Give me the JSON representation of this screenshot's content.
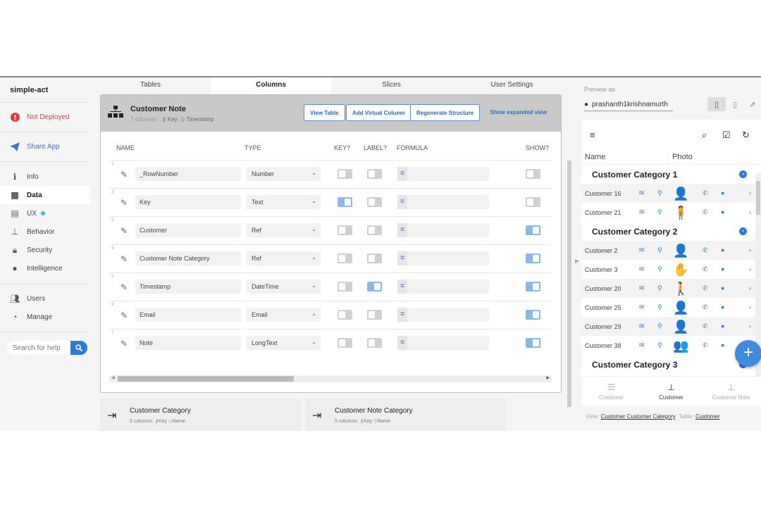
{
  "sidebar": {
    "app_name": "simple-act",
    "deploy_status": "Not Deployed",
    "share": "Share App",
    "nav": [
      {
        "label": "Info",
        "icon": "info-icon"
      },
      {
        "label": "Data",
        "icon": "grid-icon",
        "active": true
      },
      {
        "label": "UX",
        "icon": "ux-icon",
        "badge": true
      },
      {
        "label": "Behavior",
        "icon": "hierarchy-icon"
      },
      {
        "label": "Security",
        "icon": "lock-icon"
      },
      {
        "label": "Intelligence",
        "icon": "lightbulb-icon"
      }
    ],
    "nav2": [
      {
        "label": "Users",
        "icon": "users-icon"
      },
      {
        "label": "Manage",
        "icon": "dashboard-icon"
      }
    ],
    "search_placeholder": "Search for help"
  },
  "tabs": [
    "Tables",
    "Columns",
    "Slices",
    "User Settings"
  ],
  "active_tab": "Columns",
  "table": {
    "title": "Customer Note",
    "count": "7 columns:",
    "key": "Key",
    "label": "Timestamp",
    "buttons": {
      "view": "View Table",
      "add": "Add Virtual Column",
      "regen": "Regenerate Structure"
    },
    "expand_link": "Show expanded view",
    "headers": {
      "name": "NAME",
      "type": "TYPE",
      "key": "KEY?",
      "label": "LABEL?",
      "formula": "FORMULA",
      "show": "SHOW?"
    },
    "rows": [
      {
        "n": "1",
        "name": "_RowNumber",
        "type": "Number",
        "key": false,
        "label": false,
        "show": false
      },
      {
        "n": "2",
        "name": "Key",
        "type": "Text",
        "key": true,
        "label": false,
        "show": false
      },
      {
        "n": "3",
        "name": "Customer",
        "type": "Ref",
        "key": false,
        "label": false,
        "show": true
      },
      {
        "n": "4",
        "name": "Customer Note Category",
        "type": "Ref",
        "key": false,
        "label": false,
        "show": true
      },
      {
        "n": "5",
        "name": "Timestamp",
        "type": "DateTime",
        "key": false,
        "label": true,
        "show": true
      },
      {
        "n": "6",
        "name": "Email",
        "type": "Email",
        "key": false,
        "label": false,
        "show": true
      },
      {
        "n": "7",
        "name": "Note",
        "type": "LongText",
        "key": false,
        "label": false,
        "show": true
      }
    ],
    "formula_prefix": "="
  },
  "other_tables": [
    {
      "title": "Customer Category",
      "count": "5 columns:",
      "key": "Key",
      "label": "Name"
    },
    {
      "title": "Customer Note Category",
      "count": "5 columns:",
      "key": "Key",
      "label": "Name"
    }
  ],
  "preview": {
    "label": "Preview as",
    "user": "prashanth1krishnamurth",
    "columns": [
      "Name",
      "Photo"
    ],
    "groups": [
      {
        "title": "Customer Category 1",
        "rows": [
          {
            "name": "Customer 16",
            "photo": "👤"
          },
          {
            "name": "Customer 21",
            "photo": "🧍"
          }
        ]
      },
      {
        "title": "Customer Category 2",
        "rows": [
          {
            "name": "Customer 2",
            "photo": "👤"
          },
          {
            "name": "Customer 3",
            "photo": "✋"
          },
          {
            "name": "Customer 20",
            "photo": "🚶"
          },
          {
            "name": "Customer 25",
            "photo": "👤"
          },
          {
            "name": "Customer 29",
            "photo": "👤"
          },
          {
            "name": "Customer 38",
            "photo": "👥"
          }
        ]
      },
      {
        "title": "Customer Category 3",
        "rows": []
      }
    ],
    "nav": [
      {
        "label": "Customer",
        "icon": "list-icon"
      },
      {
        "label": "Customer",
        "icon": "hierarchy-icon",
        "active": true
      },
      {
        "label": "Customer Note",
        "icon": "hierarchy-icon"
      }
    ],
    "footer": {
      "view_label": "View:",
      "view": "Customer Customer Category",
      "table_label": "Table:",
      "table": "Customer"
    }
  }
}
